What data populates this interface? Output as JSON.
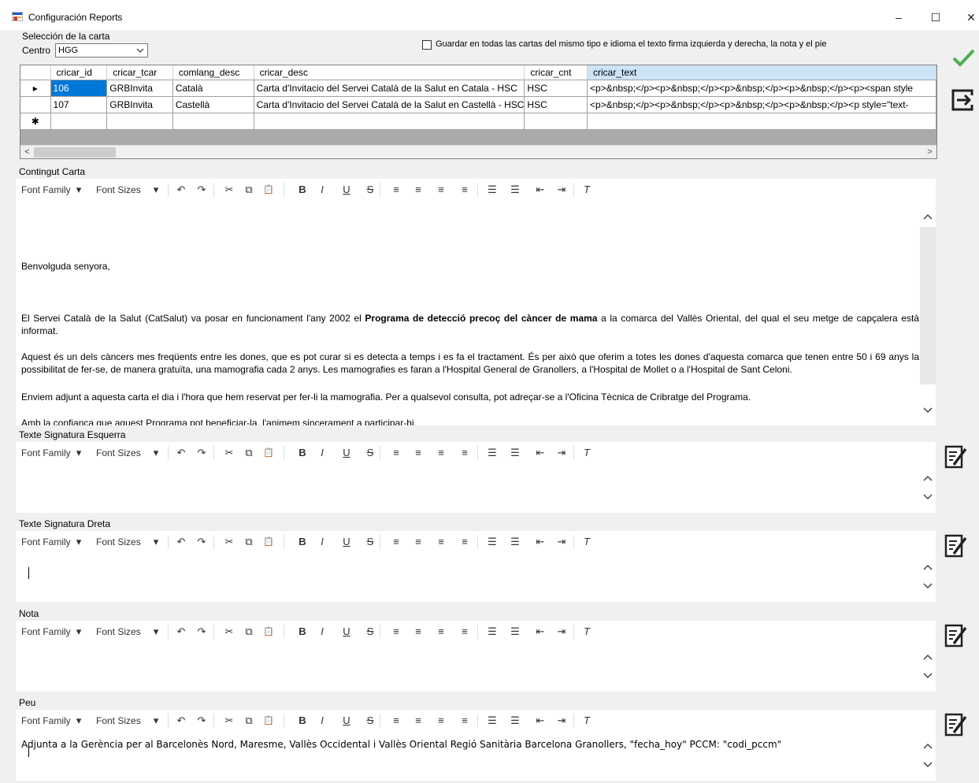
{
  "window": {
    "title": "Configuración Reports",
    "minimize": "–",
    "maximize": "☐",
    "close": "✕"
  },
  "selection": {
    "group_label": "Selección de la carta",
    "centro_label": "Centro",
    "centro_value": "HGG",
    "checkbox_label": "Guardar en todas las cartas del mismo tipo e idioma el texto firma izquierda y derecha, la nota y el pie",
    "checkbox_checked": false
  },
  "grid": {
    "columns": [
      "cricar_id",
      "cricar_tcar",
      "comlang_desc",
      "cricar_desc",
      "cricar_cnt",
      "cricar_text"
    ],
    "rows": [
      [
        "106",
        "GRBInvita",
        "Català",
        "Carta d'Invitacio del Servei Català de la Salut  en Catala - HSC",
        "HSC",
        "<p>&nbsp;</p><p>&nbsp;</p><p>&nbsp;</p><p>&nbsp;</p><p><span style"
      ],
      [
        "107",
        "GRBInvita",
        "Castellà",
        "Carta d'Invitacio del Servei Català de la Salut  en Castellà - HSC",
        "HSC",
        "<p>&nbsp;</p><p>&nbsp;</p><p>&nbsp;</p><p>&nbsp;</p><p style=\"text-"
      ]
    ],
    "current_row_marker": "▸",
    "new_row_marker": "✱"
  },
  "toolbar": {
    "font_family": "Font Family",
    "font_sizes": "Font Sizes"
  },
  "sections": {
    "contingut": "Contingut Carta",
    "sig_left": "Texte Signatura Esquerra",
    "sig_right": "Texte Signatura Dreta",
    "nota": "Nota",
    "peu": "Peu"
  },
  "content": {
    "greeting": "Benvolguda senyora,",
    "p1_before": "El Servei Català de la Salut (CatSalut) va posar en funcionament l'any 2002 el ",
    "p1_bold": "Programa de detecció precoç del càncer de mama",
    "p1_after": " a la comarca del Vallès Oriental, del qual el seu metge de capçalera està informat.",
    "p2": "Aquest és un dels càncers mes freqüents entre les dones, que es pot curar si es detecta a temps i es fa el tractament. És per això que oferim a totes les dones d'aquesta comarca que tenen entre 50 i 69 anys la possibilitat de fer-se, de manera gratuïta, una mamografia cada 2 anys. Les mamografies es faran a l'Hospital General de Granollers, a l'Hospital de Mollet o a l'Hospital de Sant Celoni.",
    "p3": "Enviem adjunt a aquesta carta el dia i l'hora que hem reservat per fer-li la mamografia. Per a qualsevol consulta, pot adreçar-se a l'Oficina Tècnica de Cribratge del Programa.",
    "p4": "Amb la confiança que aquest Programa pot beneficiar-la, l'animem sincerament a participar-hi."
  },
  "peu": {
    "text": "Adjunta a la Gerència per al Barcelonès Nord, Maresme, Vallès Occidental i Vallès Oriental Regió Sanitària Barcelona Granollers, \"fecha_hoy\" PCCM: \"codi_pccm\""
  },
  "colors": {
    "accept_green": "#4caf50",
    "selection_blue": "#0078d7"
  }
}
